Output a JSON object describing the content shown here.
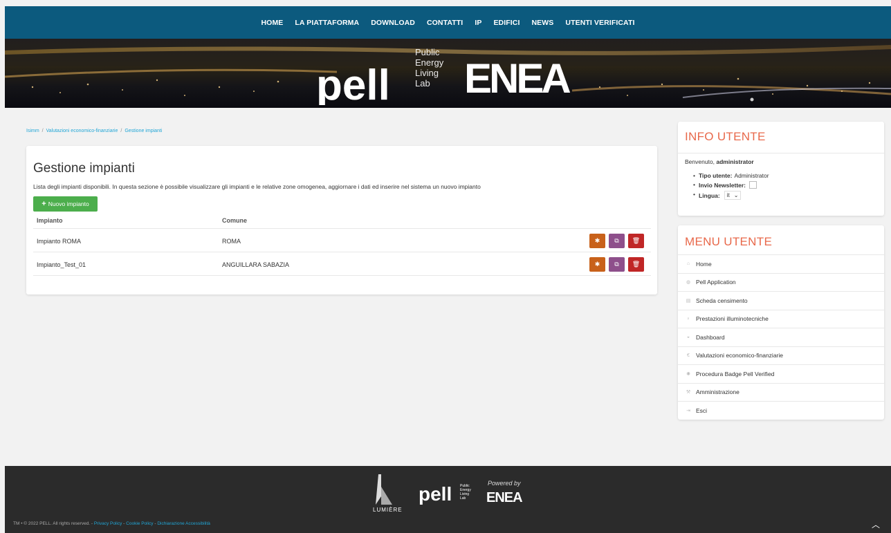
{
  "nav": {
    "items": [
      "HOME",
      "LA PIATTAFORMA",
      "DOWNLOAD",
      "CONTATTI",
      "IP",
      "EDIFICI",
      "NEWS",
      "UTENTI VERIFICATI"
    ]
  },
  "banner": {
    "pell_word": "pell",
    "pell_sub": [
      "Public",
      "Energy",
      "Living",
      "Lab"
    ],
    "enea_word": "ENEA"
  },
  "breadcrumb": [
    "Isimm",
    "Valutazioni economico-finanziarie",
    "Gestione impianti"
  ],
  "main": {
    "title": "Gestione impianti",
    "description": "Lista degli impianti disponibili. In questa sezione è possibile visualizzare gli impianti e le relative zone omogenea, aggiornare i dati ed inserire nel sistema un nuovo impianto",
    "new_button": "Nuovo impianto",
    "columns": [
      "Impianto",
      "Comune"
    ],
    "rows": [
      {
        "impianto": "Impianto ROMA",
        "comune": "ROMA"
      },
      {
        "impianto": "Impianto_Test_01",
        "comune": "ANGUILLARA SABAZIA"
      }
    ]
  },
  "info": {
    "title": "INFO UTENTE",
    "welcome_prefix": "Benvenuto,",
    "username": "administrator",
    "tipo_label": "Tipo utente:",
    "tipo_value": "Administrator",
    "newsletter_label": "Invio Newsletter:",
    "lingua_label": "Lingua:",
    "lingua_value": "it"
  },
  "menu": {
    "title": "MENU UTENTE",
    "items": [
      {
        "label": "Home",
        "icon": "home-icon"
      },
      {
        "label": "Pell Application",
        "icon": "globe-icon"
      },
      {
        "label": "Scheda censimento",
        "icon": "document-icon"
      },
      {
        "label": "Prestazioni illuminotecniche",
        "icon": "bulb-icon"
      },
      {
        "label": "Dashboard",
        "icon": "dashboard-icon"
      },
      {
        "label": "Valutazioni economico-finanziarie",
        "icon": "euro-icon"
      },
      {
        "label": "Procedura Badge Pell Verified",
        "icon": "badge-icon"
      },
      {
        "label": "Amministrazione",
        "icon": "wrench-icon"
      },
      {
        "label": "Esci",
        "icon": "logout-icon"
      }
    ]
  },
  "footer": {
    "lumiere": "LUMIÈRE",
    "pell_word": "pell",
    "pell_sub": [
      "Public",
      "Energy",
      "Living",
      "Lab"
    ],
    "powered_by": "Powered by",
    "enea_word": "ENEA",
    "copyright": "TM • © 2022 PELL. All rights reserved. -",
    "links": [
      "Privacy Policy",
      "Cookie Policy",
      "Dichiarazione Accessibilità"
    ],
    "link_sep": " - "
  },
  "colors": {
    "nav_bg": "#0c5a7e",
    "accent": "#21a6d6",
    "heading_orange": "#e8684a",
    "btn_green": "#4cae4c",
    "btn_orange": "#c8611a",
    "btn_purple": "#8e4f8b",
    "btn_red": "#c02626"
  }
}
